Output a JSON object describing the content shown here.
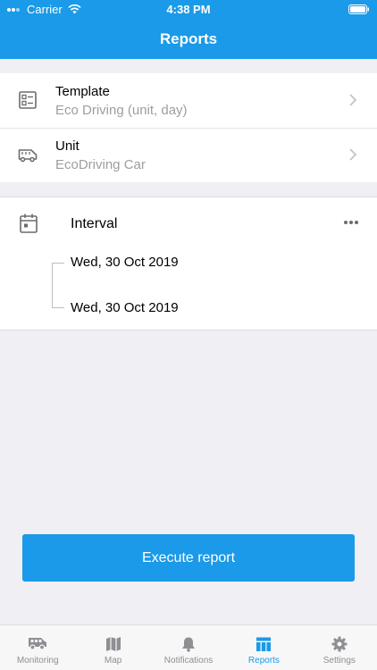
{
  "status": {
    "carrier": "Carrier",
    "time": "4:38 PM"
  },
  "header": {
    "title": "Reports"
  },
  "template_row": {
    "title": "Template",
    "value": "Eco Driving (unit, day)"
  },
  "unit_row": {
    "title": "Unit",
    "value": "EcoDriving Car"
  },
  "interval": {
    "title": "Interval",
    "from": "Wed, 30 Oct 2019",
    "to": "Wed, 30 Oct 2019"
  },
  "execute": {
    "label": "Execute report"
  },
  "tabs": [
    {
      "label": "Monitoring",
      "icon": "van-icon"
    },
    {
      "label": "Map",
      "icon": "map-icon"
    },
    {
      "label": "Notifications",
      "icon": "bell-icon"
    },
    {
      "label": "Reports",
      "icon": "table-icon",
      "active": true
    },
    {
      "label": "Settings",
      "icon": "gear-icon"
    }
  ],
  "colors": {
    "accent": "#1a9ae8",
    "background": "#efeff4",
    "muted": "#9e9ea2"
  }
}
